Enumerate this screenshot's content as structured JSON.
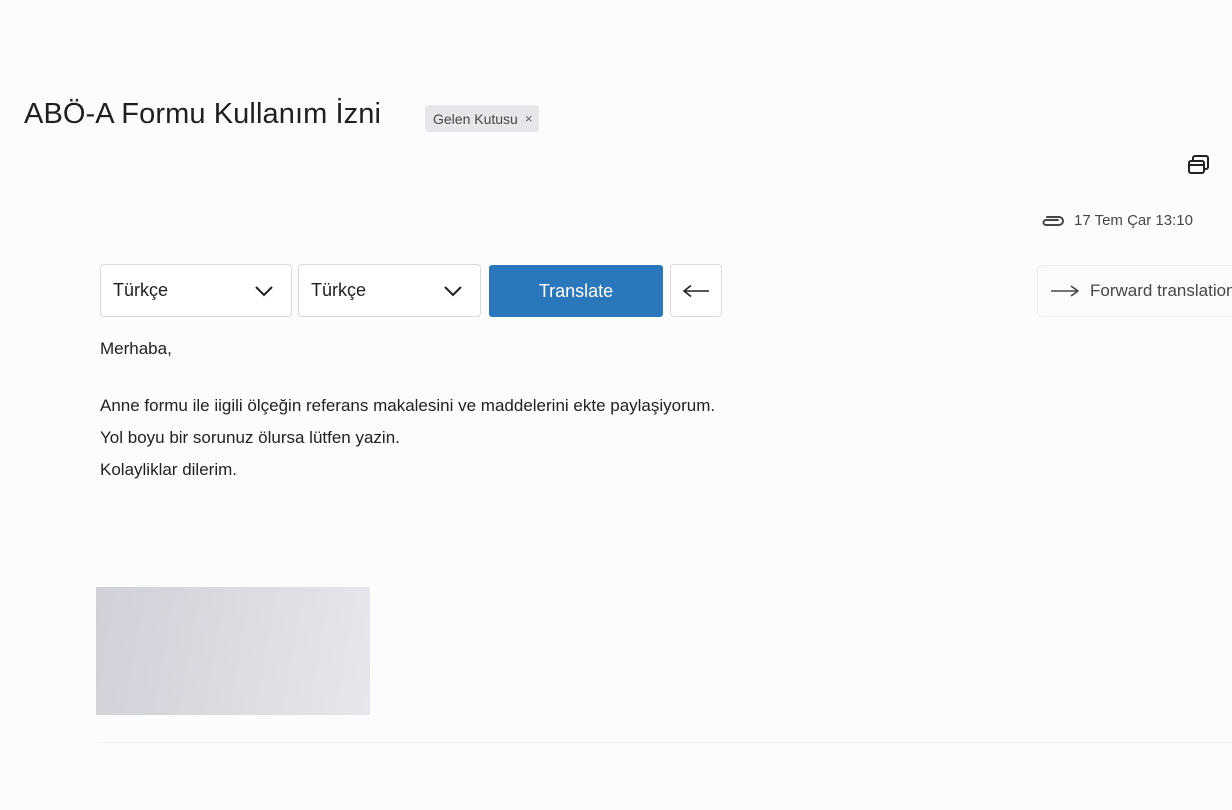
{
  "email": {
    "subject": "ABÖ-A Formu Kullanım İzni",
    "label_chip": "Gelen Kutusu",
    "label_chip_close": "×",
    "date": "17 Tem Çar 13:10"
  },
  "translation_bar": {
    "source_language": "Türkçe",
    "target_language": "Türkçe",
    "translate_label": "Translate",
    "forward_label": "Forward translation"
  },
  "body": {
    "greeting": "Merhaba,",
    "lines": [
      "Anne formu ile iigili ölçeğin referans makalesini ve maddelerini ekte paylaşiyorum.",
      "Yol boyu bir sorunuz ölursa lütfen yazin.",
      "Kolayliklar dilerim."
    ]
  },
  "icons": {
    "new_window": "new-window-icon",
    "attachment": "paperclip-icon",
    "forward": "arrow-right-icon",
    "back": "arrow-left-icon",
    "dropdown": "chevron-down-icon"
  },
  "colors": {
    "translate_button": "#2b77bb",
    "chip_background": "#e6e7ea"
  }
}
